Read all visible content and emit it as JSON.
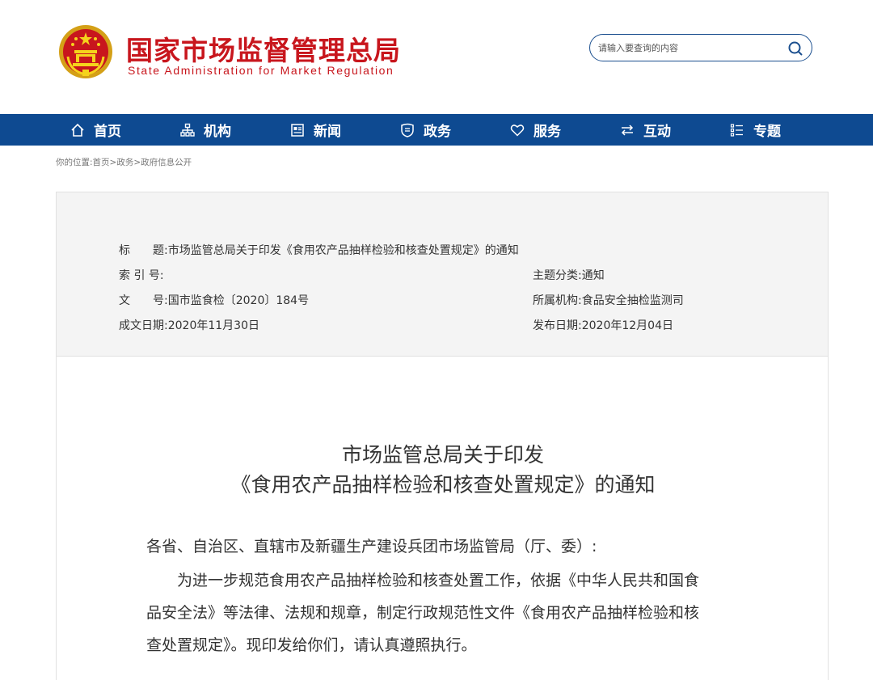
{
  "header": {
    "title": "国家市场监督管理总局",
    "subtitle": "State Administration for Market Regulation",
    "emblem_icon": "national-emblem-icon",
    "brand_color": "#c8161d"
  },
  "search": {
    "placeholder": "请输入要查询的内容",
    "icon": "search-icon"
  },
  "nav": {
    "background": "#0e4a91",
    "items": [
      {
        "label": "首页",
        "icon": "home-icon"
      },
      {
        "label": "机构",
        "icon": "org-chart-icon"
      },
      {
        "label": "新闻",
        "icon": "news-icon"
      },
      {
        "label": "政务",
        "icon": "government-icon"
      },
      {
        "label": "服务",
        "icon": "heart-icon"
      },
      {
        "label": "互动",
        "icon": "exchange-icon"
      },
      {
        "label": "专题",
        "icon": "list-icon"
      }
    ]
  },
  "breadcrumb": {
    "prefix": "你的位置:",
    "items": [
      "首页",
      "政务",
      "政府信息公开"
    ],
    "separator": ">"
  },
  "info": {
    "title_label": "标　　题:",
    "title_value": "市场监管总局关于印发《食用农产品抽样检验和核查处置规定》的通知",
    "index_label": "索 引 号:",
    "index_value": "",
    "topic_label": "主题分类:",
    "topic_value": "通知",
    "doc_label": "文　　号:",
    "doc_value": "国市监食检〔2020〕184号",
    "org_label": "所属机构:",
    "org_value": "食品安全抽检监测司",
    "created_label": "成文日期:",
    "created_value": "2020年11月30日",
    "published_label": "发布日期:",
    "published_value": "2020年12月04日"
  },
  "article": {
    "title_line1": "市场监管总局关于印发",
    "title_line2": "《食用农产品抽样检验和核查处置规定》的通知",
    "salutation": "各省、自治区、直辖市及新疆生产建设兵团市场监管局（厅、委）:",
    "body_line1": "　　为进一步规范食用农产品抽样检验和核查处置工作，依据《中华人民共和国食",
    "body_line2": "品安全法》等法律、法规和规章，制定行政规范性文件《食用农产品抽样检验和核",
    "body_line3": "查处置规定》。现印发给你们，请认真遵照执行。"
  }
}
